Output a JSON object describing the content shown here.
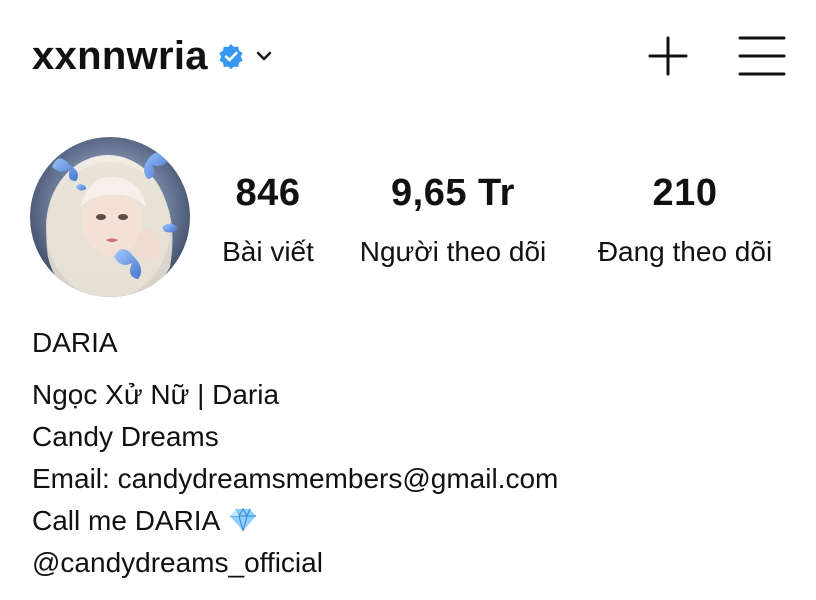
{
  "header": {
    "username": "xxnnwria",
    "verified_icon": "verified-badge-icon",
    "switch_icon": "chevron-down-icon",
    "create_icon": "plus-icon",
    "menu_icon": "hamburger-menu-icon",
    "verified_color": "#3897f0"
  },
  "profile": {
    "avatar": "profile-avatar"
  },
  "stats": {
    "posts": {
      "value": "846",
      "label": "Bài viết"
    },
    "followers": {
      "value": "9,65 Tr",
      "label": "Người theo dõi"
    },
    "following": {
      "value": "210",
      "label": "Đang theo dõi"
    }
  },
  "bio": {
    "name": "DARIA",
    "line1": "Ngọc Xử Nữ | Daria",
    "line2": "Candy Dreams",
    "line3": "Email: candydreamsmembers@gmail.com",
    "line4": "Call me DARIA",
    "line4_icon": "gem-icon",
    "tag": "@candydreams_official"
  }
}
